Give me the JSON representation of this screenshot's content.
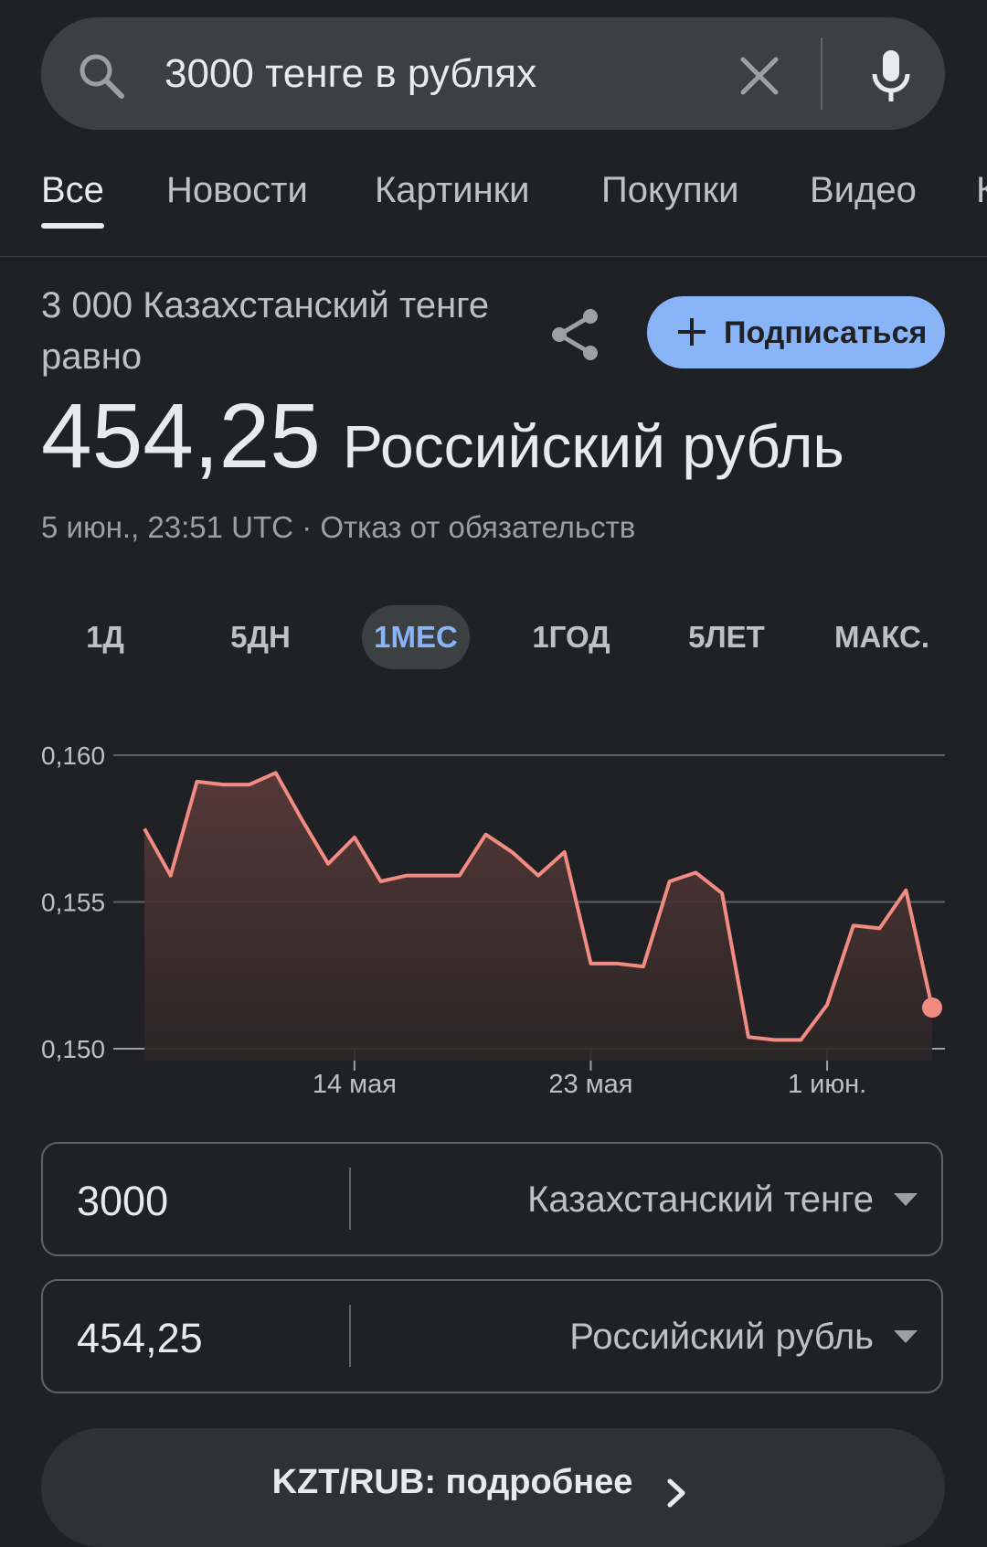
{
  "search": {
    "query": "3000 тенге в рублях"
  },
  "tabs": [
    {
      "label": "Все",
      "active": true
    },
    {
      "label": "Новости",
      "active": false
    },
    {
      "label": "Картинки",
      "active": false
    },
    {
      "label": "Покупки",
      "active": false
    },
    {
      "label": "Видео",
      "active": false
    }
  ],
  "converter": {
    "subtitle": "3 000 Казахстанский тенге равно",
    "result_value": "454,25",
    "result_currency": "Российский рубль",
    "timestamp": "5 июн., 23:51 UTC",
    "disclaimer": "Отказ от обязательств",
    "subscribe_label": "Подписаться",
    "from_amount": "3000",
    "from_currency": "Казахстанский тенге",
    "to_amount": "454,25",
    "to_currency": "Российский рубль",
    "more_label": "KZT/RUB: подробнее"
  },
  "ranges": [
    {
      "label": "1Д",
      "active": false
    },
    {
      "label": "5ДН",
      "active": false
    },
    {
      "label": "1МЕС",
      "active": true
    },
    {
      "label": "1ГОД",
      "active": false
    },
    {
      "label": "5ЛЕТ",
      "active": false
    },
    {
      "label": "МАКС.",
      "active": false
    }
  ],
  "colors": {
    "background": "#202124",
    "accent": "#8ab4f8",
    "line": "#f28b82"
  },
  "chart_data": {
    "type": "area",
    "y_ticks": [
      "0,160",
      "0,155",
      "0,150"
    ],
    "ylim": [
      0.15,
      0.16
    ],
    "x_ticks": [
      {
        "label": "14 мая",
        "index": 8
      },
      {
        "label": "23 мая",
        "index": 17
      },
      {
        "label": "1 июн.",
        "index": 26
      }
    ],
    "values": [
      0.1575,
      0.1559,
      0.1591,
      0.159,
      0.159,
      0.1594,
      0.1578,
      0.1563,
      0.1572,
      0.1557,
      0.1559,
      0.1559,
      0.1559,
      0.1573,
      0.1567,
      0.1559,
      0.1567,
      0.1529,
      0.1529,
      0.1528,
      0.1557,
      0.156,
      0.1553,
      0.1504,
      0.1503,
      0.1503,
      0.1515,
      0.1542,
      0.1541,
      0.1554,
      0.1514
    ]
  }
}
